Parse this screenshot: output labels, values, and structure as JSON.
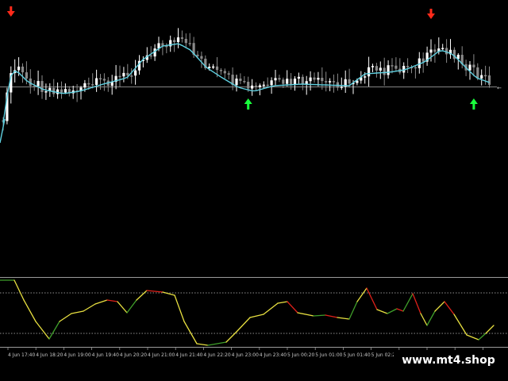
{
  "chart_data": [
    {
      "type": "candlestick",
      "panel": "price",
      "indicator": "moving-average",
      "signals": [
        {
          "kind": "sell",
          "bar": 2,
          "color": "#ff2a1a"
        },
        {
          "kind": "buy",
          "bar": 63,
          "color": "#19ff3c"
        },
        {
          "kind": "sell",
          "bar": 110,
          "color": "#ff2a1a"
        },
        {
          "kind": "buy",
          "bar": 121,
          "color": "#19ff3c"
        }
      ],
      "colors": {
        "candle_up": "#ffffff",
        "candle_down": "#8a8a8a",
        "ma": "#5fd0e0",
        "price_line": "#b0b0b0"
      }
    },
    {
      "type": "line",
      "panel": "oscillator",
      "ylim": [
        0,
        100
      ],
      "levels": [
        80,
        20
      ],
      "colors": {
        "rising": "#3f9f2a",
        "falling": "#e0201a",
        "turn": "#e8e040",
        "level": "#bdbdbd"
      }
    }
  ],
  "x_axis": {
    "ticks": [
      "4 Jun 17:40",
      "4 Jun 18:20",
      "4 Jun 19:00",
      "4 Jun 19:40",
      "4 Jun 20:20",
      "4 Jun 21:00",
      "4 Jun 21:40",
      "4 Jun 22:20",
      "4 Jun 23:00",
      "4 Jun 23:40",
      "5 Jun 00:20",
      "5 Jun 01:00",
      "5 Jun 01:40",
      "5 Jun 02:20",
      "5 Jun 03:00",
      "5 Jun 03:40",
      "5 Jun 04:20",
      "5 Jun 05:00"
    ]
  },
  "watermark": "www.mt4.shop",
  "price_marker": "←"
}
